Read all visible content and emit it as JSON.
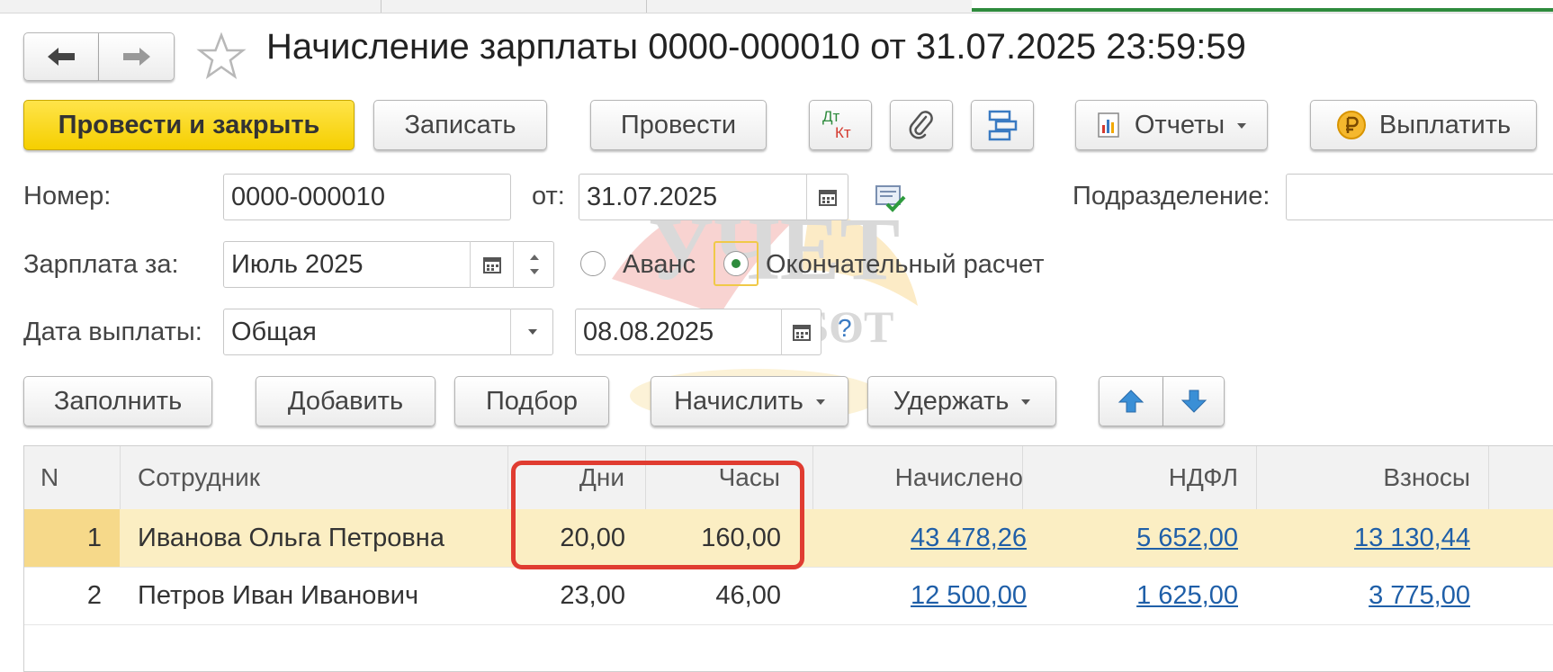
{
  "window": {
    "title": "Начисление зарплаты 0000-000010 от 31.07.2025 23:59:59"
  },
  "nav": {
    "back_icon": "arrow-left-icon",
    "forward_icon": "arrow-right-icon",
    "favorite_icon": "star-icon"
  },
  "toolbar": {
    "post_close_label": "Провести и закрыть",
    "save_label": "Записать",
    "post_label": "Провести",
    "dtkt_top": "Дт",
    "dtkt_bottom": "Кт",
    "reports_label": "Отчеты",
    "pay_label": "Выплатить"
  },
  "form": {
    "number_label": "Номер:",
    "number_value": "0000-000010",
    "date_label": "от:",
    "date_value": "31.07.2025",
    "division_label": "Подразделение:",
    "division_value": "",
    "salary_for_label": "Зарплата за:",
    "salary_for_value": "Июль 2025",
    "advance_label": "Аванс",
    "final_label": "Окончательный расчет",
    "pay_date_label": "Дата выплаты:",
    "pay_date_type": "Общая",
    "pay_date_value": "08.08.2025",
    "help": "?"
  },
  "table_toolbar": {
    "fill_label": "Заполнить",
    "add_label": "Добавить",
    "pick_label": "Подбор",
    "accrue_label": "Начислить",
    "deduct_label": "Удержать"
  },
  "table": {
    "headers": {
      "n": "N",
      "employee": "Сотрудник",
      "days": "Дни",
      "hours": "Часы",
      "accrued": "Начислено",
      "ndfl": "НДФЛ",
      "contributions": "Взносы"
    },
    "rows": [
      {
        "n": "1",
        "employee": "Иванова Ольга Петровна",
        "days": "20,00",
        "hours": "160,00",
        "accrued": "43 478,26",
        "ndfl": "5 652,00",
        "contributions": "13 130,44"
      },
      {
        "n": "2",
        "employee": "Петров Иван Иванович",
        "days": "23,00",
        "hours": "46,00",
        "accrued": "12 500,00",
        "ndfl": "1 625,00",
        "contributions": "3 775,00"
      }
    ]
  },
  "watermark": {
    "line1": "УЧЕТ",
    "line2": "БЕЗ ЗАБОТ"
  },
  "colors": {
    "primary_button": "#f5cf00",
    "selected_row": "#fbeec3",
    "highlight_box": "#e03c31",
    "link": "#1f5fa8",
    "active_tab": "#2e8b3d"
  }
}
